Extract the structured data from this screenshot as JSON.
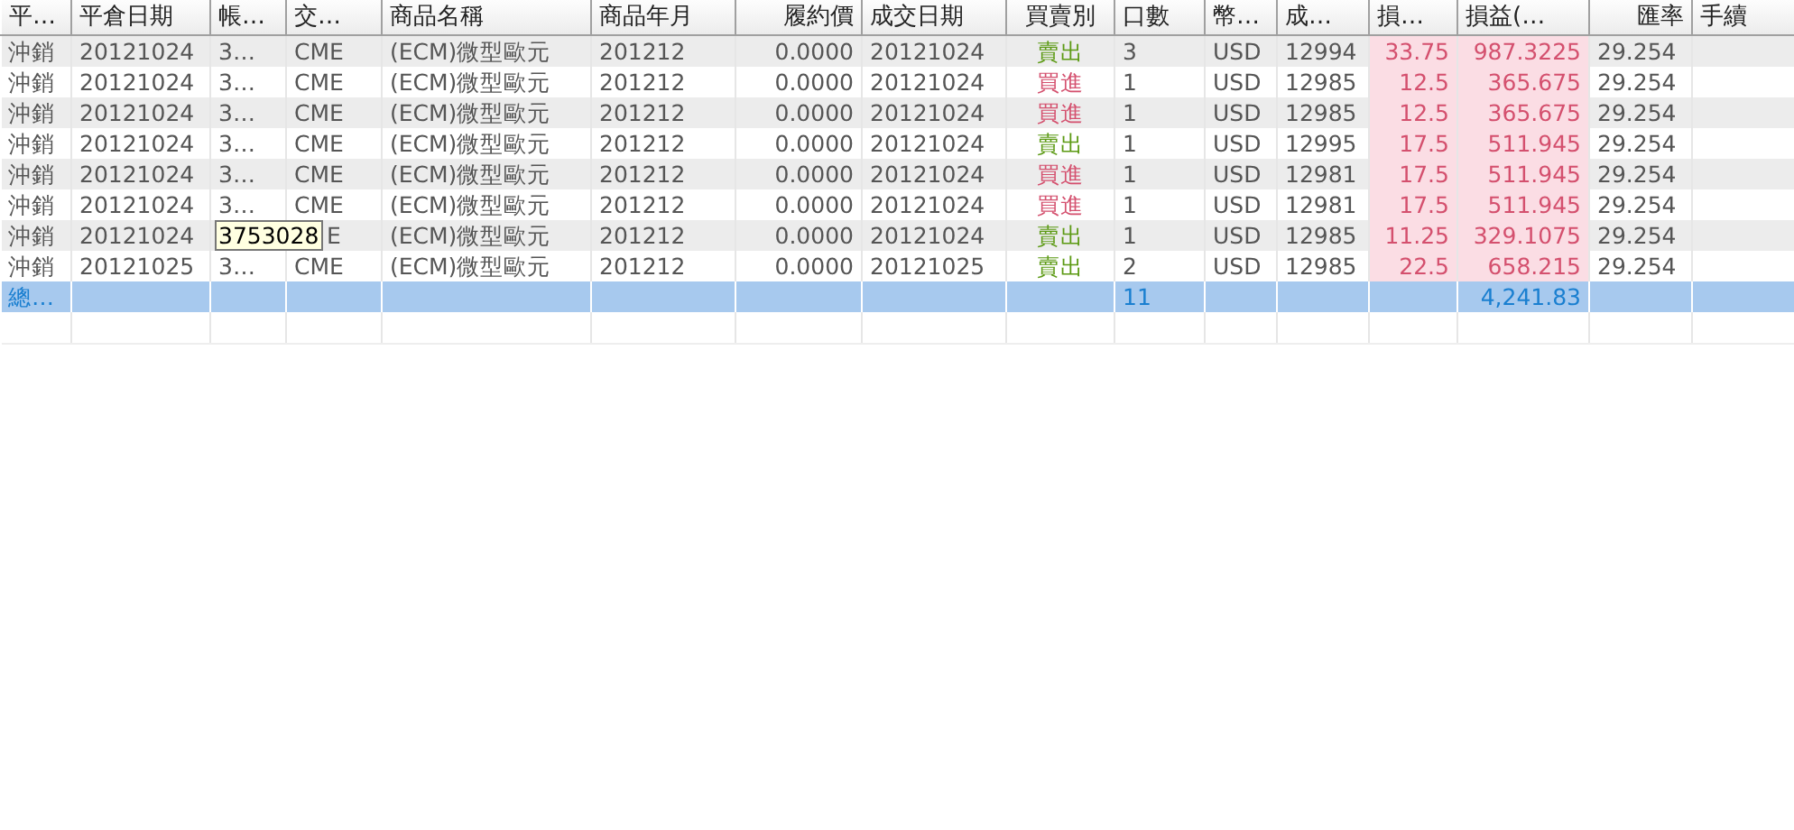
{
  "table": {
    "columns": [
      "平…",
      "平倉日期",
      "帳…",
      "交…",
      "商品名稱",
      "商品年月",
      "履約價",
      "成交日期",
      "買賣別",
      "口數",
      "幣…",
      "成…",
      "損…",
      "損益(…",
      "匯率",
      "手續"
    ],
    "rows": [
      {
        "column_1": "沖銷",
        "close_date": "20121024",
        "column_3": "3…",
        "column_4": "CME",
        "product_name": "(ECM)微型歐元",
        "product_month": "201212",
        "strike_price": "0.0000",
        "trade_date": "20121024",
        "side": {
          "text": "賣出",
          "color": "#5c9a14"
        },
        "lots": "3",
        "column_11": "USD",
        "column_12": "12994",
        "column_13": "33.75",
        "column_14": "987.3225",
        "exchange_rate": "29.254"
      },
      {
        "column_1": "沖銷",
        "close_date": "20121024",
        "column_3": "3…",
        "column_4": "CME",
        "product_name": "(ECM)微型歐元",
        "product_month": "201212",
        "strike_price": "0.0000",
        "trade_date": "20121024",
        "side": {
          "text": "買進",
          "color": "#d4506e"
        },
        "lots": "1",
        "column_11": "USD",
        "column_12": "12985",
        "column_13": "12.5",
        "column_14": "365.675",
        "exchange_rate": "29.254"
      },
      {
        "column_1": "沖銷",
        "close_date": "20121024",
        "column_3": "3…",
        "column_4": "CME",
        "product_name": "(ECM)微型歐元",
        "product_month": "201212",
        "strike_price": "0.0000",
        "trade_date": "20121024",
        "side": {
          "text": "買進",
          "color": "#d4506e"
        },
        "lots": "1",
        "column_11": "USD",
        "column_12": "12985",
        "column_13": "12.5",
        "column_14": "365.675",
        "exchange_rate": "29.254"
      },
      {
        "column_1": "沖銷",
        "close_date": "20121024",
        "column_3": "3…",
        "column_4": "CME",
        "product_name": "(ECM)微型歐元",
        "product_month": "201212",
        "strike_price": "0.0000",
        "trade_date": "20121024",
        "side": {
          "text": "賣出",
          "color": "#5c9a14"
        },
        "lots": "1",
        "column_11": "USD",
        "column_12": "12995",
        "column_13": "17.5",
        "column_14": "511.945",
        "exchange_rate": "29.254"
      },
      {
        "column_1": "沖銷",
        "close_date": "20121024",
        "column_3": "3…",
        "column_4": "CME",
        "product_name": "(ECM)微型歐元",
        "product_month": "201212",
        "strike_price": "0.0000",
        "trade_date": "20121024",
        "side": {
          "text": "買進",
          "color": "#d4506e"
        },
        "lots": "1",
        "column_11": "USD",
        "column_12": "12981",
        "column_13": "17.5",
        "column_14": "511.945",
        "exchange_rate": "29.254"
      },
      {
        "column_1": "沖銷",
        "close_date": "20121024",
        "column_3": "3…",
        "column_4": "CME",
        "product_name": "(ECM)微型歐元",
        "product_month": "201212",
        "strike_price": "0.0000",
        "trade_date": "20121024",
        "side": {
          "text": "買進",
          "color": "#d4506e"
        },
        "lots": "1",
        "column_11": "USD",
        "column_12": "12981",
        "column_13": "17.5",
        "column_14": "511.945",
        "exchange_rate": "29.254"
      },
      {
        "column_1": "沖銷",
        "close_date": "20121024",
        "tooltip": "3753028",
        "column_4": "E",
        "product_name": "(ECM)微型歐元",
        "product_month": "201212",
        "strike_price": "0.0000",
        "trade_date": "20121024",
        "side": {
          "text": "賣出",
          "color": "#5c9a14"
        },
        "lots": "1",
        "column_11": "USD",
        "column_12": "12985",
        "column_13": "11.25",
        "column_14": "329.1075",
        "exchange_rate": "29.254"
      },
      {
        "column_1": "沖銷",
        "close_date": "20121025",
        "column_3": "3…",
        "column_4": "CME",
        "product_name": "(ECM)微型歐元",
        "product_month": "201212",
        "strike_price": "0.0000",
        "trade_date": "20121025",
        "side": {
          "text": "賣出",
          "color": "#5c9a14"
        },
        "lots": "2",
        "column_11": "USD",
        "column_12": "12985",
        "column_13": "22.5",
        "column_14": "658.215",
        "exchange_rate": "29.254"
      }
    ],
    "total": {
      "column_1": "總…",
      "lots": "11",
      "column_14": "4,241.83"
    }
  }
}
